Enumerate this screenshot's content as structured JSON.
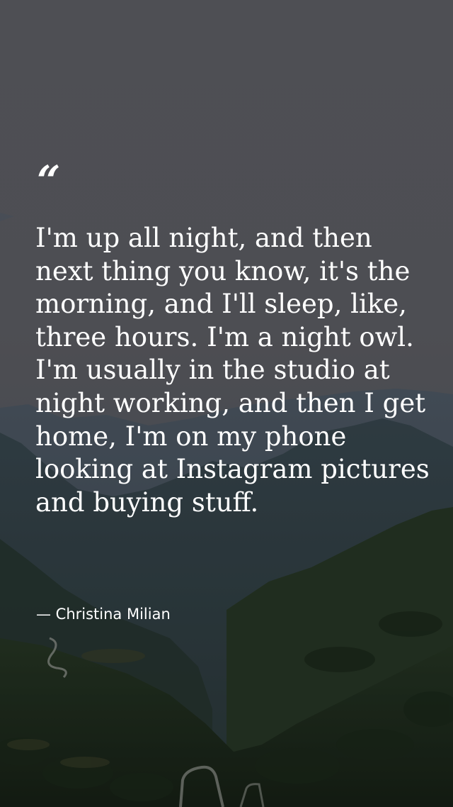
{
  "quote": {
    "mark": "“",
    "text": "I'm up all night, and then next thing you know, it's the morning, and I'll sleep, like, three hours. I'm a night owl. I'm usually in the studio at night working, and then I get home, I'm on my phone looking at Instagram pictures and buying stuff.",
    "attribution": "— Christina Milian"
  },
  "background": {
    "description_colors": {
      "sky": "#5a5b60",
      "mountains_far": "#3e4a56",
      "mountains_mid": "#2b3a3c",
      "forest": "#1e2e1c",
      "text": "#ffffff"
    }
  }
}
